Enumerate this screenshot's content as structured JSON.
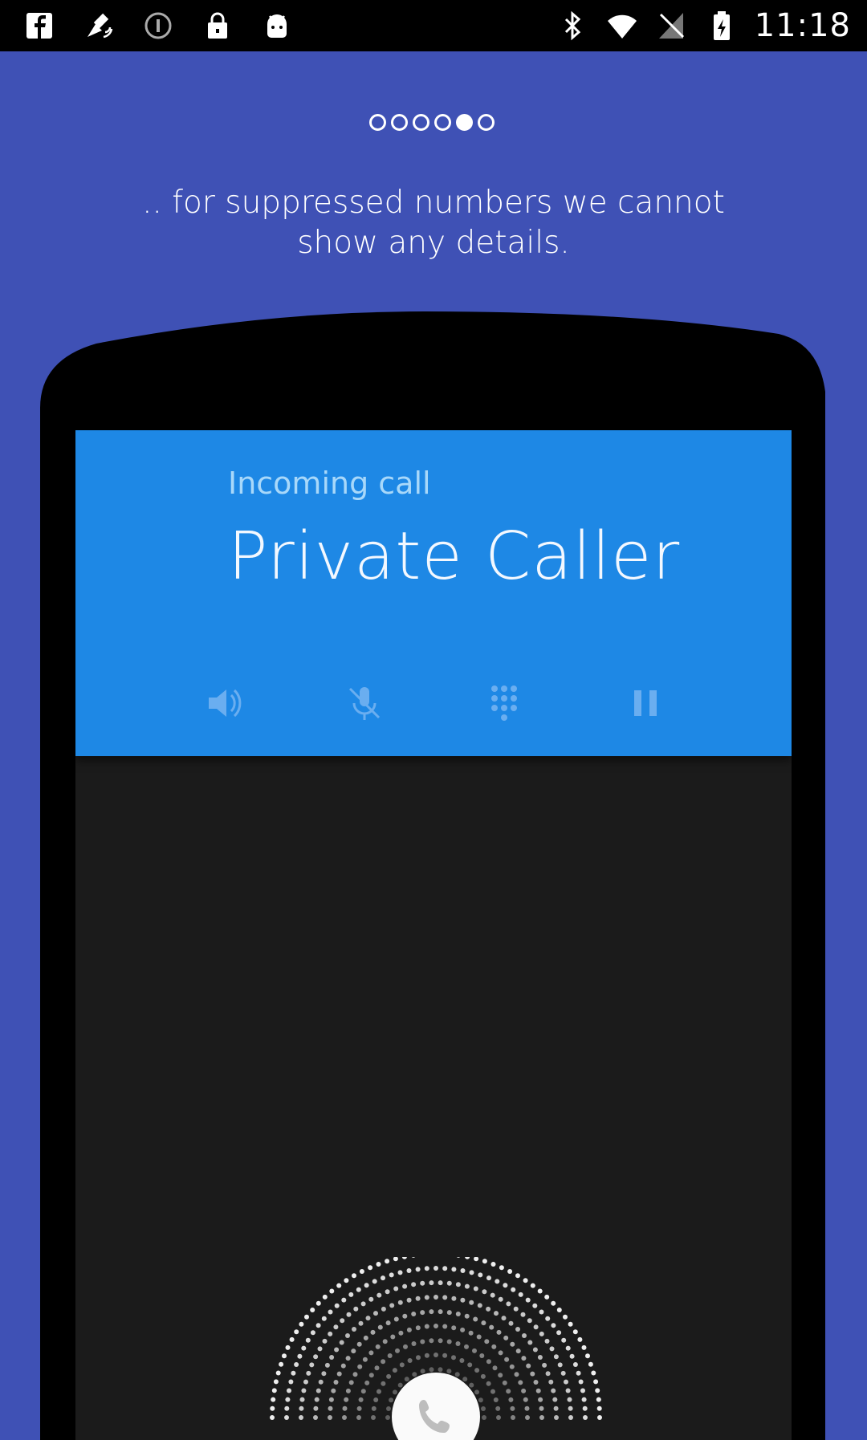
{
  "status_bar": {
    "left_icons": [
      "facebook-icon",
      "satellite-icon",
      "info-icon",
      "lock-icon",
      "android-icon"
    ],
    "right_icons": [
      "bluetooth-icon",
      "wifi-icon",
      "no-sim-icon",
      "battery-charging-icon"
    ],
    "time": "11:18"
  },
  "page_indicator": {
    "total": 6,
    "active_index": 4
  },
  "description": ".. for suppressed numbers we cannot show any details.",
  "phone_screen": {
    "call_label": "Incoming call",
    "caller_name": "Private Caller",
    "controls": [
      "speaker-icon",
      "mute-icon",
      "dialpad-icon",
      "pause-icon"
    ],
    "answer_icon": "phone-icon",
    "colors": {
      "background": "#3f51b5",
      "call_header": "#1e88e5",
      "screen": "#1b1b1b"
    }
  }
}
